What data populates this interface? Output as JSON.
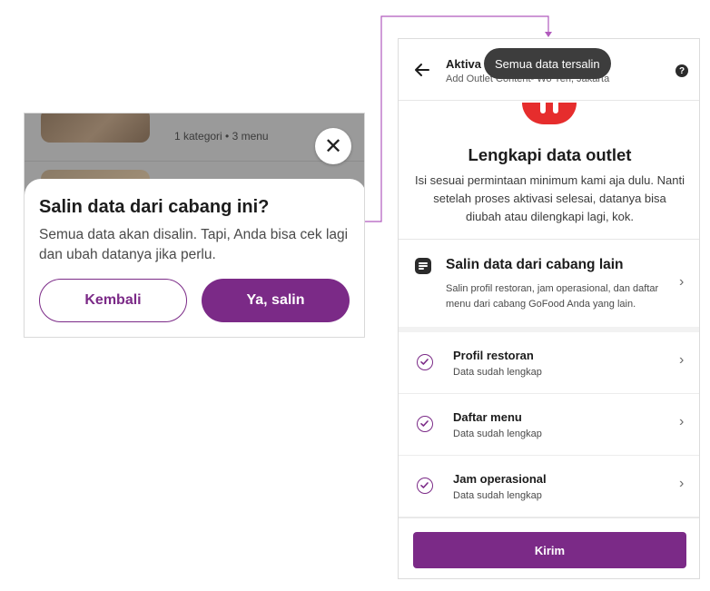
{
  "left_panel": {
    "background": {
      "meta_text": "1 kategori  •  3 menu"
    },
    "close_glyph": "✕",
    "sheet": {
      "title": "Salin data dari cabang ini?",
      "description": "Semua data akan disalin. Tapi, Anda bisa cek lagi dan ubah datanya jika perlu.",
      "back_button": "Kembali",
      "confirm_button": "Ya, salin"
    }
  },
  "right_panel": {
    "header": {
      "title": "Aktiva",
      "subtitle": "Add Outlet Content- Wo Yen, Jakarta",
      "help_glyph": "?"
    },
    "toast": "Semua data tersalin",
    "main": {
      "title": "Lengkapi data outlet",
      "description": "Isi sesuai permintaan minimum kami aja dulu. Nanti setelah proses aktivasi selesai, datanya bisa diubah atau dilengkapi lagi, kok."
    },
    "copy_option": {
      "title": "Salin data dari cabang lain",
      "description": "Salin profil restoran, jam operasional, dan daftar menu dari cabang GoFood Anda yang lain."
    },
    "checklist": [
      {
        "title": "Profil restoran",
        "status": "Data sudah lengkap"
      },
      {
        "title": "Daftar menu",
        "status": "Data sudah lengkap"
      },
      {
        "title": "Jam operasional",
        "status": "Data sudah lengkap"
      }
    ],
    "submit_button": "Kirim"
  },
  "icons": [
    "back-arrow-icon",
    "help-icon",
    "close-icon",
    "document-icon",
    "check-circle-icon",
    "chevron-right-icon"
  ],
  "colors": {
    "brand_purple": "#7b2a87",
    "toast_bg": "#3d3d3d",
    "accent_red": "#e62d2d",
    "connector_line": "#b15bbd"
  }
}
